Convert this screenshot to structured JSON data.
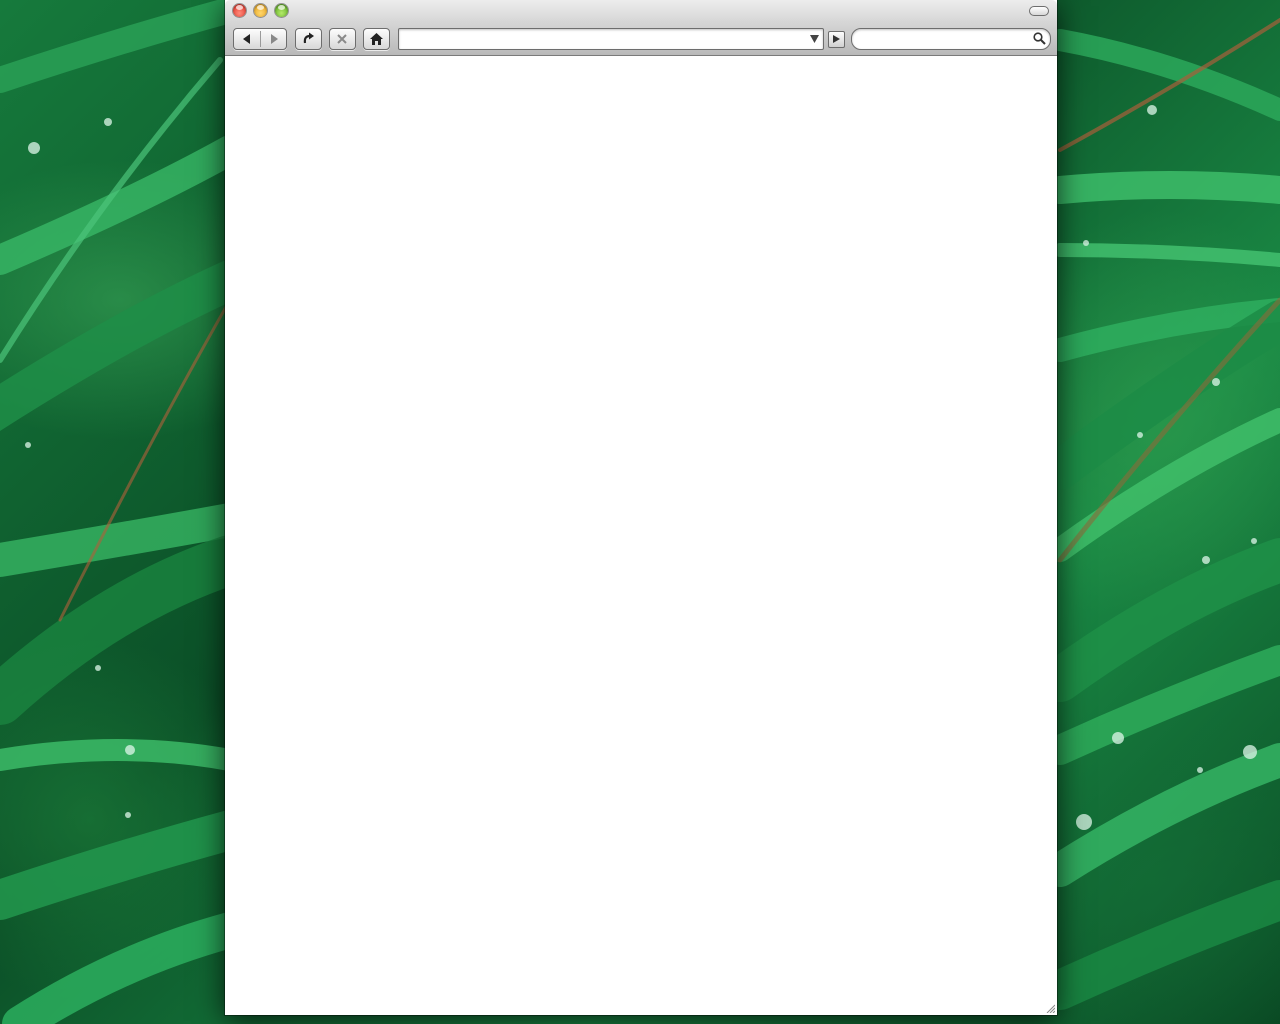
{
  "browser": {
    "title": "",
    "address": {
      "value": "",
      "placeholder": ""
    },
    "search": {
      "value": "",
      "placeholder": ""
    }
  },
  "colors": {
    "window_bg": "#ffffff",
    "toolbar": "#c8c8c8",
    "close": "#d9261c",
    "minimize": "#e09a12",
    "zoom": "#4c9e14",
    "desktop": "#167a3c"
  },
  "icons": {
    "back": "back-arrow-icon",
    "forward": "forward-arrow-icon",
    "reload": "reload-icon",
    "stop": "stop-icon",
    "home": "home-icon",
    "dropdown": "chevron-down-icon",
    "go": "go-arrow-icon",
    "search": "magnifier-icon"
  }
}
